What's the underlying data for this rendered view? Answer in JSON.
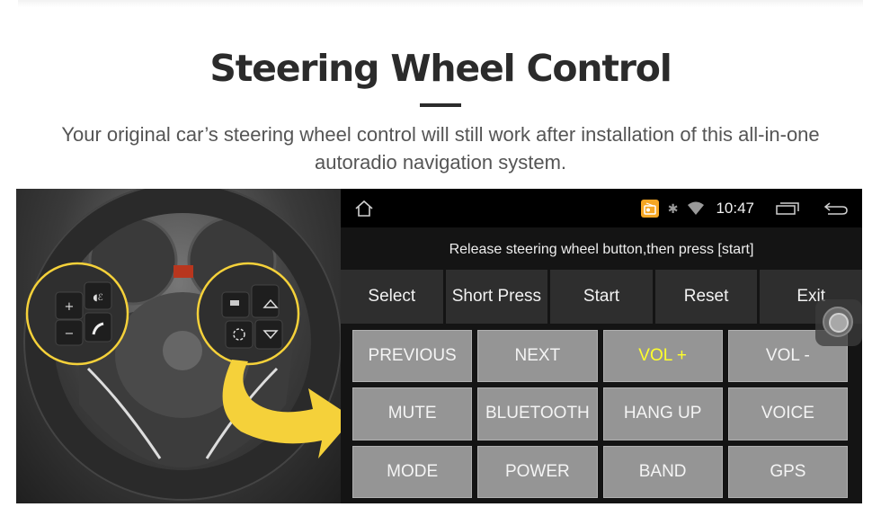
{
  "header": {
    "title": "Steering Wheel Control",
    "subtitle": "Your original car’s steering wheel control will still work after installation of this all-in-one autoradio navigation system."
  },
  "photo": {
    "description": "Steering wheel with highlighted control buttons",
    "left_cluster": [
      "+",
      "−",
      "voice",
      "phone"
    ],
    "right_cluster": [
      "mode",
      "source",
      "up",
      "down"
    ],
    "highlight_color": "#f5d13a"
  },
  "screen": {
    "status_bar": {
      "home_icon": "home-icon",
      "icons": [
        "radio-icon",
        "bluetooth-icon",
        "wifi-icon"
      ],
      "time": "10:47",
      "recent_apps_icon": "recent-apps-icon",
      "back_icon": "back-icon",
      "accent": "#f5a623"
    },
    "instruction": "Release steering wheel button,then press [start]",
    "tabs": [
      {
        "label": "Select"
      },
      {
        "label": "Short Press"
      },
      {
        "label": "Start"
      },
      {
        "label": "Reset"
      },
      {
        "label": "Exit"
      }
    ],
    "keys": [
      {
        "label": "PREVIOUS",
        "active": false
      },
      {
        "label": "NEXT",
        "active": false
      },
      {
        "label": "VOL +",
        "active": true
      },
      {
        "label": "VOL -",
        "active": false
      },
      {
        "label": "MUTE",
        "active": false
      },
      {
        "label": "BLUETOOTH",
        "active": false
      },
      {
        "label": "HANG UP",
        "active": false
      },
      {
        "label": "VOICE",
        "active": false
      },
      {
        "label": "MODE",
        "active": false
      },
      {
        "label": "POWER",
        "active": false
      },
      {
        "label": "BAND",
        "active": false
      },
      {
        "label": "GPS",
        "active": false
      }
    ],
    "active_key_color": "#ffff2a"
  }
}
